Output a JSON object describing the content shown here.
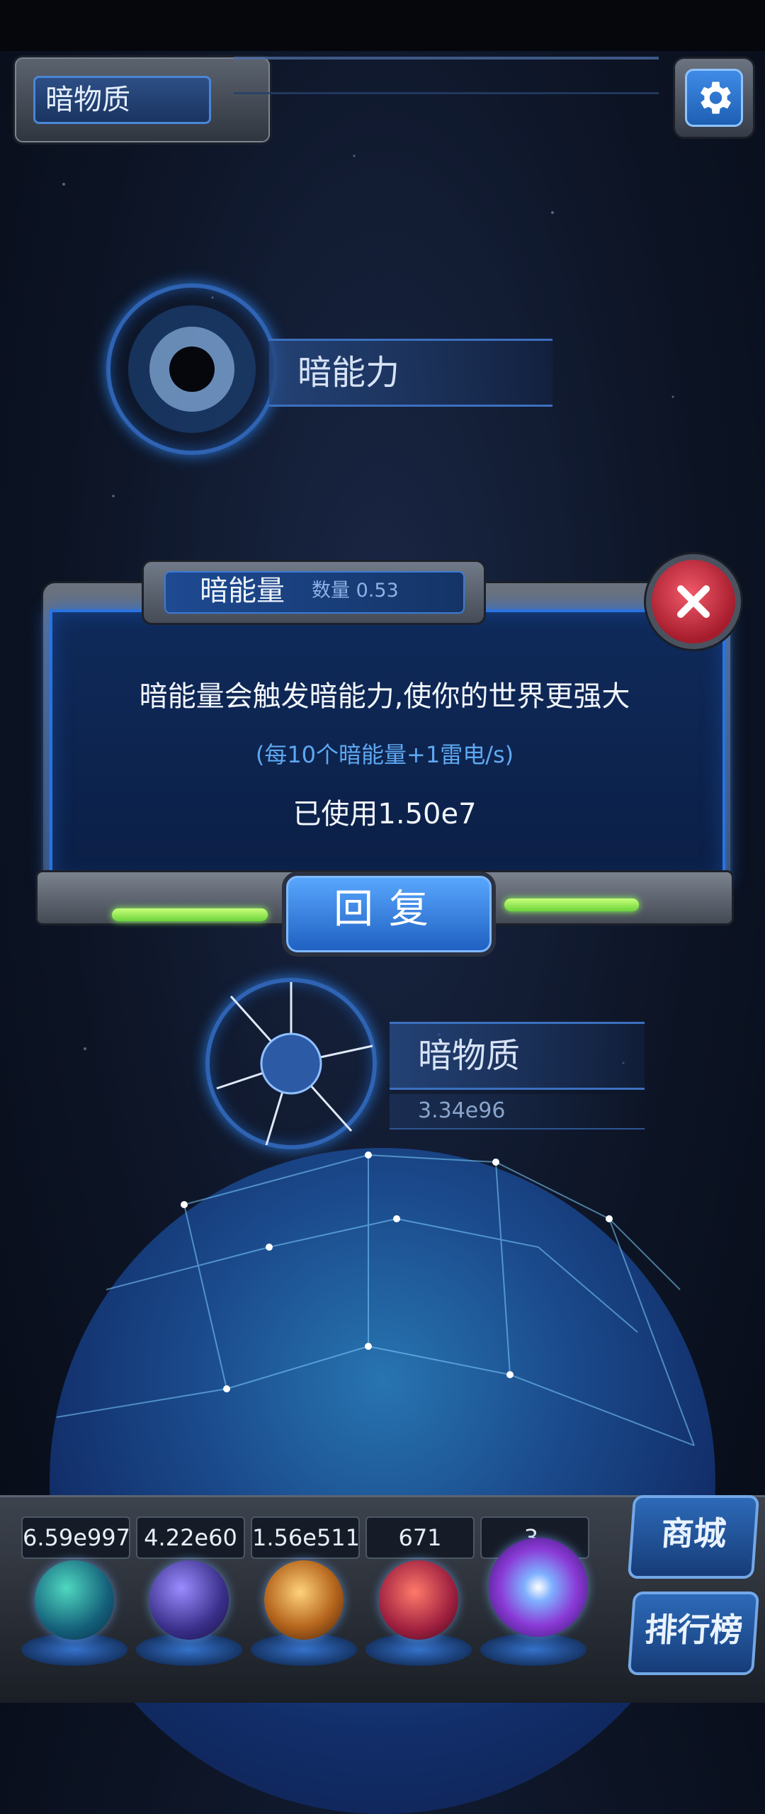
{
  "header": {
    "title": "暗物质",
    "settings_icon": "gear-icon"
  },
  "nodes": {
    "dark_ability": {
      "label": "暗能力"
    },
    "dark_matter": {
      "label": "暗物质",
      "value": "3.34e96"
    }
  },
  "dialog": {
    "title": "暗能量",
    "count_label": "数量 0.53",
    "main_text": "暗能量会触发暗能力,使你的世界更强大",
    "sub_text": "(每10个暗能量+1雷电/s)",
    "used_text": "已使用1.50e7",
    "restore_button": "回复",
    "close_icon": "close-icon"
  },
  "resources": [
    {
      "value": "6.59e997",
      "icon": "green-planet-orb-icon"
    },
    {
      "value": "4.22e60",
      "icon": "lightning-orb-icon"
    },
    {
      "value": "1.56e511",
      "icon": "galaxy-orb-icon"
    },
    {
      "value": "671",
      "icon": "red-crystal-orb-icon"
    },
    {
      "value": "3.",
      "icon": "purple-vortex-orb-icon"
    }
  ],
  "side_buttons": {
    "shop": "商城",
    "leaderboard": "排行榜"
  },
  "colors": {
    "accent_blue": "#2a73e0",
    "close_red": "#d8303f",
    "energy_green": "#8cff5a"
  }
}
